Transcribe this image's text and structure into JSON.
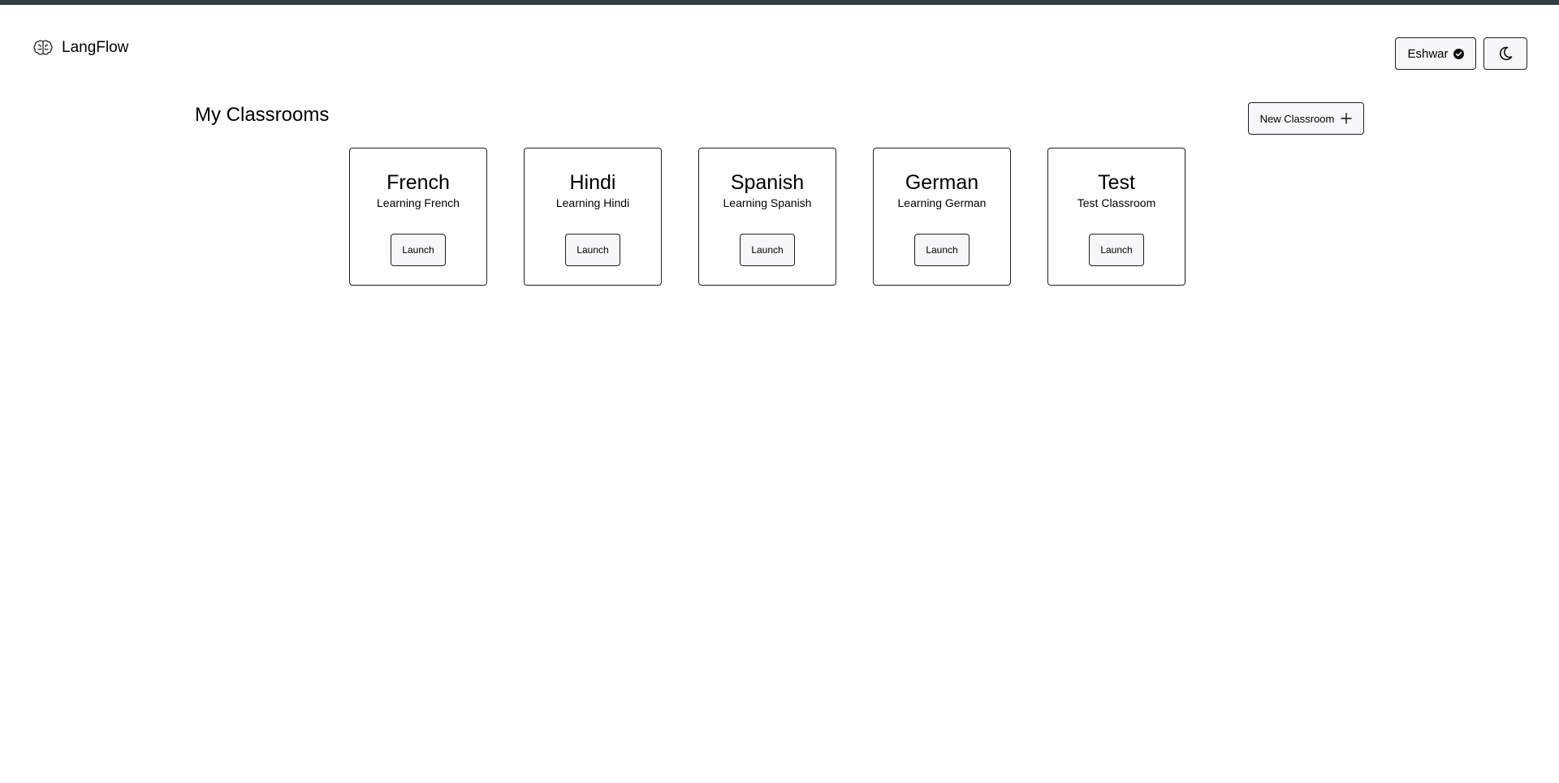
{
  "brand": {
    "name": "LangFlow",
    "logo_icon": "brain-icon"
  },
  "header": {
    "user_label": "Eshwar",
    "user_badge_icon": "check-circle-icon",
    "theme_icon": "moon-icon"
  },
  "main": {
    "title": "My Classrooms",
    "new_button_label": "New Classroom",
    "new_button_icon": "plus-icon",
    "classrooms": [
      {
        "title": "French",
        "description": "Learning French",
        "action": "Launch"
      },
      {
        "title": "Hindi",
        "description": "Learning Hindi",
        "action": "Launch"
      },
      {
        "title": "Spanish",
        "description": "Learning Spanish",
        "action": "Launch"
      },
      {
        "title": "German",
        "description": "Learning German",
        "action": "Launch"
      },
      {
        "title": "Test",
        "description": "Test Classroom",
        "action": "Launch"
      }
    ]
  },
  "colors": {
    "top_strip": "#2f3f42",
    "button_bg": "#f6f7f8",
    "border": "#1f1f1f",
    "text": "#000000"
  }
}
